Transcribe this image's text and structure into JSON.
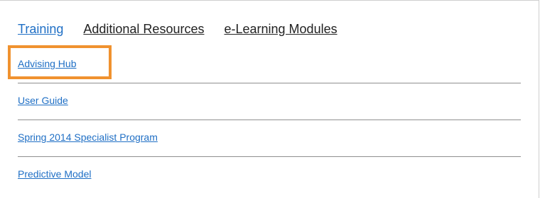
{
  "tabs": [
    {
      "label": "Training",
      "active": true
    },
    {
      "label": "Additional Resources",
      "active": false
    },
    {
      "label": "e-Learning Modules",
      "active": false
    }
  ],
  "links": [
    {
      "label": "Advising Hub"
    },
    {
      "label": "User Guide"
    },
    {
      "label": "Spring 2014 Specialist Program"
    },
    {
      "label": "Predictive Model"
    }
  ],
  "colors": {
    "link": "#1f6fc5",
    "highlight": "#f0922f",
    "divider": "#8f8f8f"
  }
}
